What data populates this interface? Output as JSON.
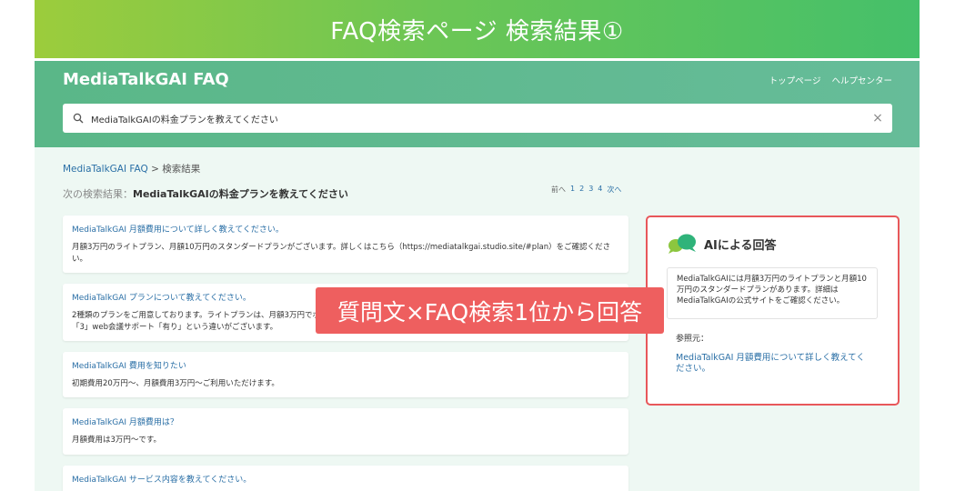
{
  "banner": {
    "title": "FAQ検索ページ 検索結果①"
  },
  "header": {
    "brand": "MediaTalkGAI FAQ",
    "nav": [
      "トップページ",
      "ヘルプセンター"
    ]
  },
  "search": {
    "value": "MediaTalkGAIの料金プランを教えてください",
    "clear_icon": "×"
  },
  "breadcrumb": {
    "home": "MediaTalkGAI FAQ",
    "separator": ">",
    "current": "検索結果"
  },
  "results_header": {
    "prefix": "次の検索結果：",
    "query": "MediaTalkGAIの料金プランを教えてください"
  },
  "pagination": {
    "prev": "前へ",
    "pages": [
      "1",
      "2",
      "3",
      "4"
    ],
    "next": "次へ"
  },
  "results": [
    {
      "title": "MediaTalkGAI 月額費用について詳しく教えてください。",
      "body": "月額3万円のライトプラン、月額10万円のスタンダードプランがございます。詳しくはこちら（https://mediatalkgai.studio.site/#plan）をご確認ください。"
    },
    {
      "title": "MediaTalkGAI プランについて教えてください。",
      "body": "2種類のプランをご用意しております。ライトプランは、月額3万円でボット数「1」web会議サポート「無し」、スタンダードプランは月額10万円でボット数「3」web会議サポート「有り」という違いがございます。"
    },
    {
      "title": "MediaTalkGAI 費用を知りたい",
      "body": "初期費用20万円〜、月額費用3万円〜ご利用いただけます。"
    },
    {
      "title": "MediaTalkGAI 月額費用は？",
      "body": "月額費用は3万円〜です。"
    },
    {
      "title": "MediaTalkGAI サービス内容を教えてください。",
      "body": ""
    }
  ],
  "ai_panel": {
    "title": "AIによる回答",
    "icon": "chat-bubbles-icon",
    "answer": "MediaTalkGAIには月額3万円のライトプランと月額10万円のスタンダードプランがあります。詳細はMediaTalkGAIの公式サイトをご確認ください。",
    "ref_label": "参照元：",
    "ref_link": "MediaTalkGAI 月額費用について詳しく教えてください。"
  },
  "callout": {
    "text": "質問文×FAQ検索1位から回答"
  },
  "colors": {
    "banner_start": "#9ccc3c",
    "banner_end": "#45c06a",
    "header": "#5ab788",
    "link": "#2a6fa6",
    "highlight": "#e8575a",
    "callout": "#ee5f5f"
  }
}
